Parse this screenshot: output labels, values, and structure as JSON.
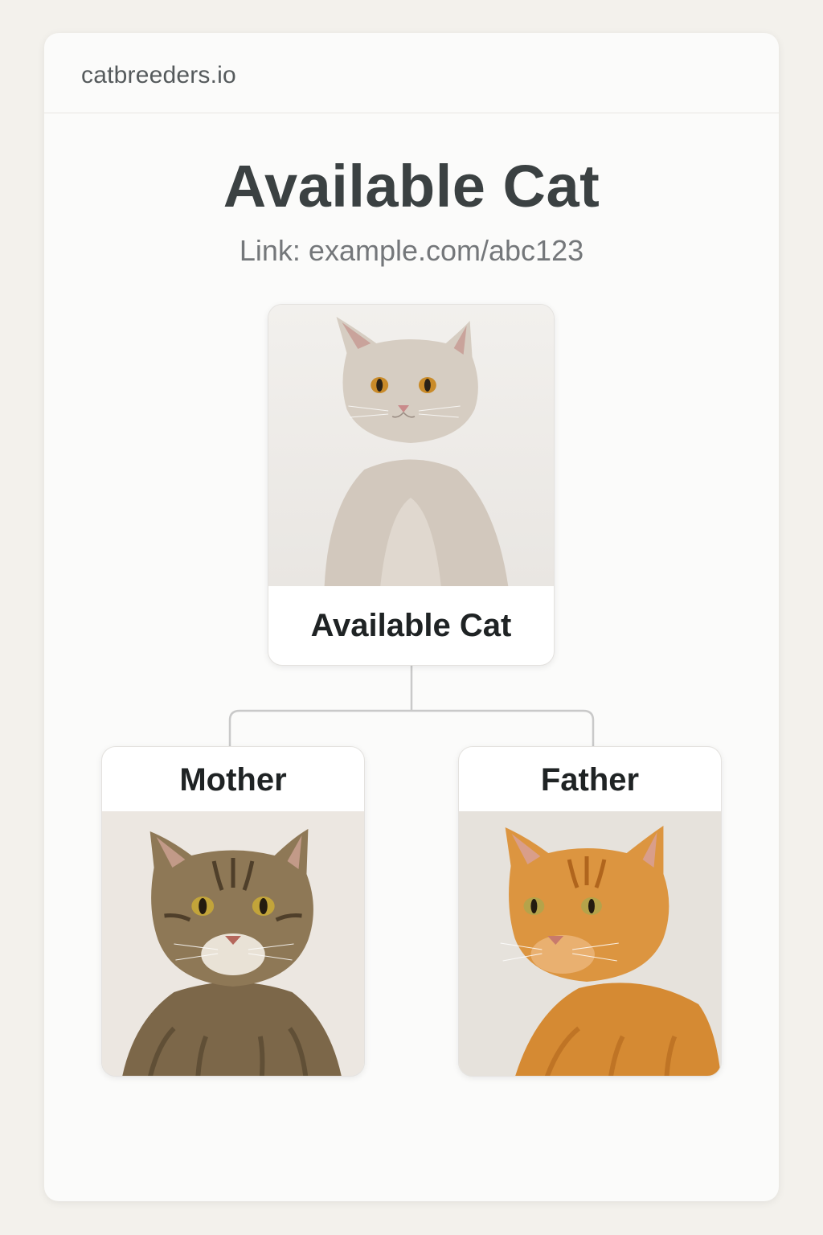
{
  "site": {
    "name": "catbreeders.io"
  },
  "page": {
    "title": "Available Cat",
    "link": "Link: example.com/abc123"
  },
  "tree": {
    "main": {
      "label": "Available Cat",
      "photo_icon": "cat-photo-cream"
    },
    "mother": {
      "label": "Mother",
      "photo_icon": "cat-photo-tabby"
    },
    "father": {
      "label": "Father",
      "photo_icon": "cat-photo-orange"
    }
  },
  "colors": {
    "page_background": "#f3f1ec",
    "card_background": "#fbfbfa",
    "title": "#3b4142",
    "connector": "#c9c9c9",
    "main_cat_fur": "#d4cbc1",
    "mother_cat_fur": "#8a7556",
    "father_cat_fur": "#d8913a"
  }
}
